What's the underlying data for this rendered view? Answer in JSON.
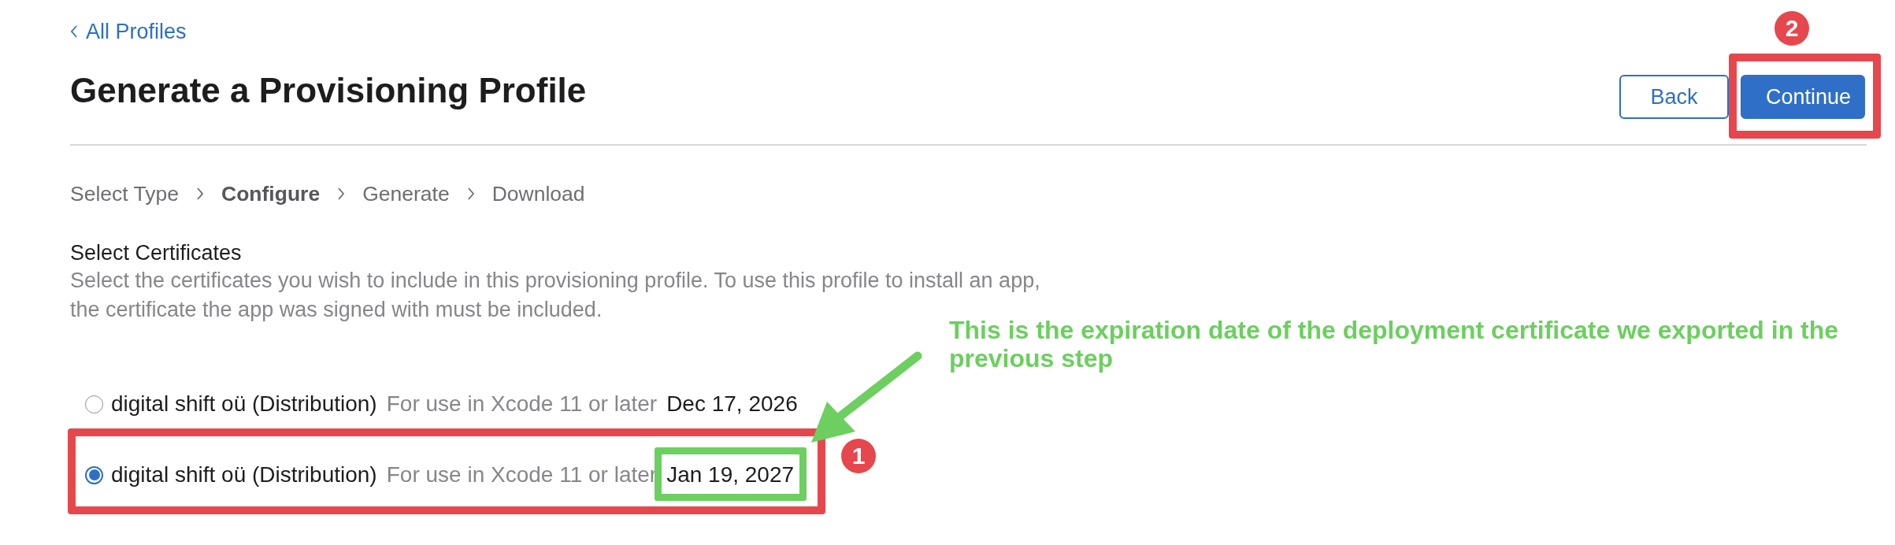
{
  "back_link": {
    "label": "All Profiles"
  },
  "title": "Generate a Provisioning Profile",
  "buttons": [
    {
      "label": "Back",
      "kind": "secondary",
      "framed": false
    },
    {
      "label": "Continue",
      "kind": "primary",
      "framed": true,
      "badge": "2"
    }
  ],
  "steps": [
    {
      "label": "Select Type",
      "selected": false
    },
    {
      "label": "Configure",
      "selected": true
    },
    {
      "label": "Generate",
      "selected": false
    },
    {
      "label": "Download",
      "selected": false
    }
  ],
  "section": {
    "heading": "Select Certificates",
    "description_lines": [
      "Select the certificates you wish to include in this provisioning profile. To use this profile to install an app,",
      "the certificate the app was signed with must be included."
    ]
  },
  "certificates": [
    {
      "name": "digital shift oü (Distribution)",
      "note": "For use in Xcode 11 or later",
      "date": "Dec 17, 2026",
      "selected": false,
      "framed": false,
      "date_framed": false
    },
    {
      "name": "digital shift oü (Distribution)",
      "note": "For use in Xcode 11 or later",
      "date": "Jan 19, 2027",
      "selected": true,
      "framed": true,
      "date_framed": true,
      "badge": "1"
    }
  ],
  "annotation": {
    "text": "This is the expiration date of the deployment certificate we exported in the previous step"
  }
}
